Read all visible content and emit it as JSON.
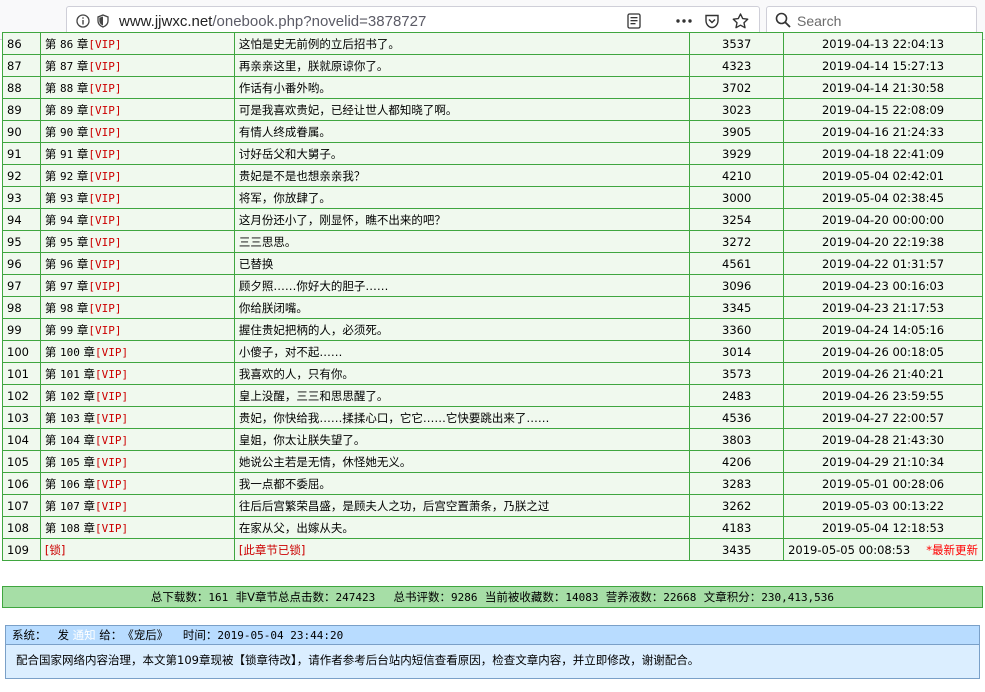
{
  "browser": {
    "url_host": "www.jjwxc.net",
    "url_path": "/onebook.php?novelid=3878727",
    "search_placeholder": "Search",
    "icons": [
      "info-icon",
      "permissions-icon",
      "reader-view-icon",
      "more-actions-icon",
      "pocket-icon",
      "bookmark-star-icon",
      "search-icon"
    ]
  },
  "chapters": [
    {
      "num": "86",
      "ch": "86",
      "tag": "[VIP]",
      "title": "这怕是史无前例的立后招书了。",
      "words": "3537",
      "date": "2019-04-13 22:04:13"
    },
    {
      "num": "87",
      "ch": "87",
      "tag": "[VIP]",
      "title": "再亲亲这里，朕就原谅你了。",
      "words": "4323",
      "date": "2019-04-14 15:27:13"
    },
    {
      "num": "88",
      "ch": "88",
      "tag": "[VIP]",
      "title": "作话有小番外哟。",
      "words": "3702",
      "date": "2019-04-14 21:30:58"
    },
    {
      "num": "89",
      "ch": "89",
      "tag": "[VIP]",
      "title": "可是我喜欢贵妃，已经让世人都知晓了啊。",
      "words": "3023",
      "date": "2019-04-15 22:08:09"
    },
    {
      "num": "90",
      "ch": "90",
      "tag": "[VIP]",
      "title": "有情人终成眷属。",
      "words": "3905",
      "date": "2019-04-16 21:24:33"
    },
    {
      "num": "91",
      "ch": "91",
      "tag": "[VIP]",
      "title": "讨好岳父和大舅子。",
      "words": "3929",
      "date": "2019-04-18 22:41:09"
    },
    {
      "num": "92",
      "ch": "92",
      "tag": "[VIP]",
      "title": "贵妃是不是也想亲亲我？",
      "words": "4210",
      "date": "2019-05-04 02:42:01"
    },
    {
      "num": "93",
      "ch": "93",
      "tag": "[VIP]",
      "title": "将军，你放肆了。",
      "words": "3000",
      "date": "2019-05-04 02:38:45"
    },
    {
      "num": "94",
      "ch": "94",
      "tag": "[VIP]",
      "title": "这月份还小了，刚显怀，瞧不出来的吧？",
      "words": "3254",
      "date": "2019-04-20 00:00:00"
    },
    {
      "num": "95",
      "ch": "95",
      "tag": "[VIP]",
      "title": "三三思思。",
      "words": "3272",
      "date": "2019-04-20 22:19:38"
    },
    {
      "num": "96",
      "ch": "96",
      "tag": "[VIP]",
      "title": "已替换",
      "words": "4561",
      "date": "2019-04-22 01:31:57"
    },
    {
      "num": "97",
      "ch": "97",
      "tag": "[VIP]",
      "title": "顾夕照……你好大的胆子……",
      "words": "3096",
      "date": "2019-04-23 00:16:03"
    },
    {
      "num": "98",
      "ch": "98",
      "tag": "[VIP]",
      "title": "你给朕闭嘴。",
      "words": "3345",
      "date": "2019-04-23 21:17:53"
    },
    {
      "num": "99",
      "ch": "99",
      "tag": "[VIP]",
      "title": "握住贵妃把柄的人，必须死。",
      "words": "3360",
      "date": "2019-04-24 14:05:16"
    },
    {
      "num": "100",
      "ch": "100",
      "tag": "[VIP]",
      "title": "小傻子，对不起……",
      "words": "3014",
      "date": "2019-04-26 00:18:05"
    },
    {
      "num": "101",
      "ch": "101",
      "tag": "[VIP]",
      "title": "我喜欢的人，只有你。",
      "words": "3573",
      "date": "2019-04-26 21:40:21"
    },
    {
      "num": "102",
      "ch": "102",
      "tag": "[VIP]",
      "title": "皇上没醒，三三和思思醒了。",
      "words": "2483",
      "date": "2019-04-26 23:59:55"
    },
    {
      "num": "103",
      "ch": "103",
      "tag": "[VIP]",
      "title": "贵妃，你快给我……揉揉心口，它它……它快要跳出来了……",
      "words": "4536",
      "date": "2019-04-27 22:00:57"
    },
    {
      "num": "104",
      "ch": "104",
      "tag": "[VIP]",
      "title": "皇姐，你太让朕失望了。",
      "words": "3803",
      "date": "2019-04-28 21:43:30"
    },
    {
      "num": "105",
      "ch": "105",
      "tag": "[VIP]",
      "title": "她说公主若是无情，休怪她无义。",
      "words": "4206",
      "date": "2019-04-29 21:10:34"
    },
    {
      "num": "106",
      "ch": "106",
      "tag": "[VIP]",
      "title": "我一点都不委屈。",
      "words": "3283",
      "date": "2019-05-01 00:28:06"
    },
    {
      "num": "107",
      "ch": "107",
      "tag": "[VIP]",
      "title": "往后后宫繁荣昌盛，是顾夫人之功，后宫空置萧条，乃朕之过",
      "words": "3262",
      "date": "2019-05-03 00:13:22"
    },
    {
      "num": "108",
      "ch": "108",
      "tag": "[VIP]",
      "title": "在家从父，出嫁从夫。",
      "words": "4183",
      "date": "2019-05-04 12:18:53"
    }
  ],
  "chapter_word": {
    "prefix": "第",
    "suffix": "章"
  },
  "locked_row": {
    "num": "109",
    "tag": "[锁]",
    "title": "[此章节已锁]",
    "words": "3435",
    "date": "2019-05-05 00:08:53",
    "newest": "*最新更新"
  },
  "stats": {
    "downloads_label": "总下载数：",
    "downloads": "161",
    "nonv_label": "非V章节总点击数：",
    "nonv": "247423",
    "reviews_label": "总书评数：",
    "reviews": "9286",
    "collect_label": "当前被收藏数：",
    "collect": "14083",
    "nutrition_label": "营养液数：",
    "nutrition": "22668",
    "score_label": "文章积分：",
    "score": "230,413,536"
  },
  "notice": {
    "system_label": "系统：",
    "send_label": "发",
    "notify_link": "通知",
    "to_label": "给：",
    "to_value": "《宠后》",
    "time_label": "时间：",
    "time_value": "2019-05-04 23:44:20",
    "body": "配合国家网络内容治理，本文第109章现被【锁章待改】，请作者参考后台站内短信查看原因，检查文章内容，并立即修改，谢谢配合。"
  }
}
